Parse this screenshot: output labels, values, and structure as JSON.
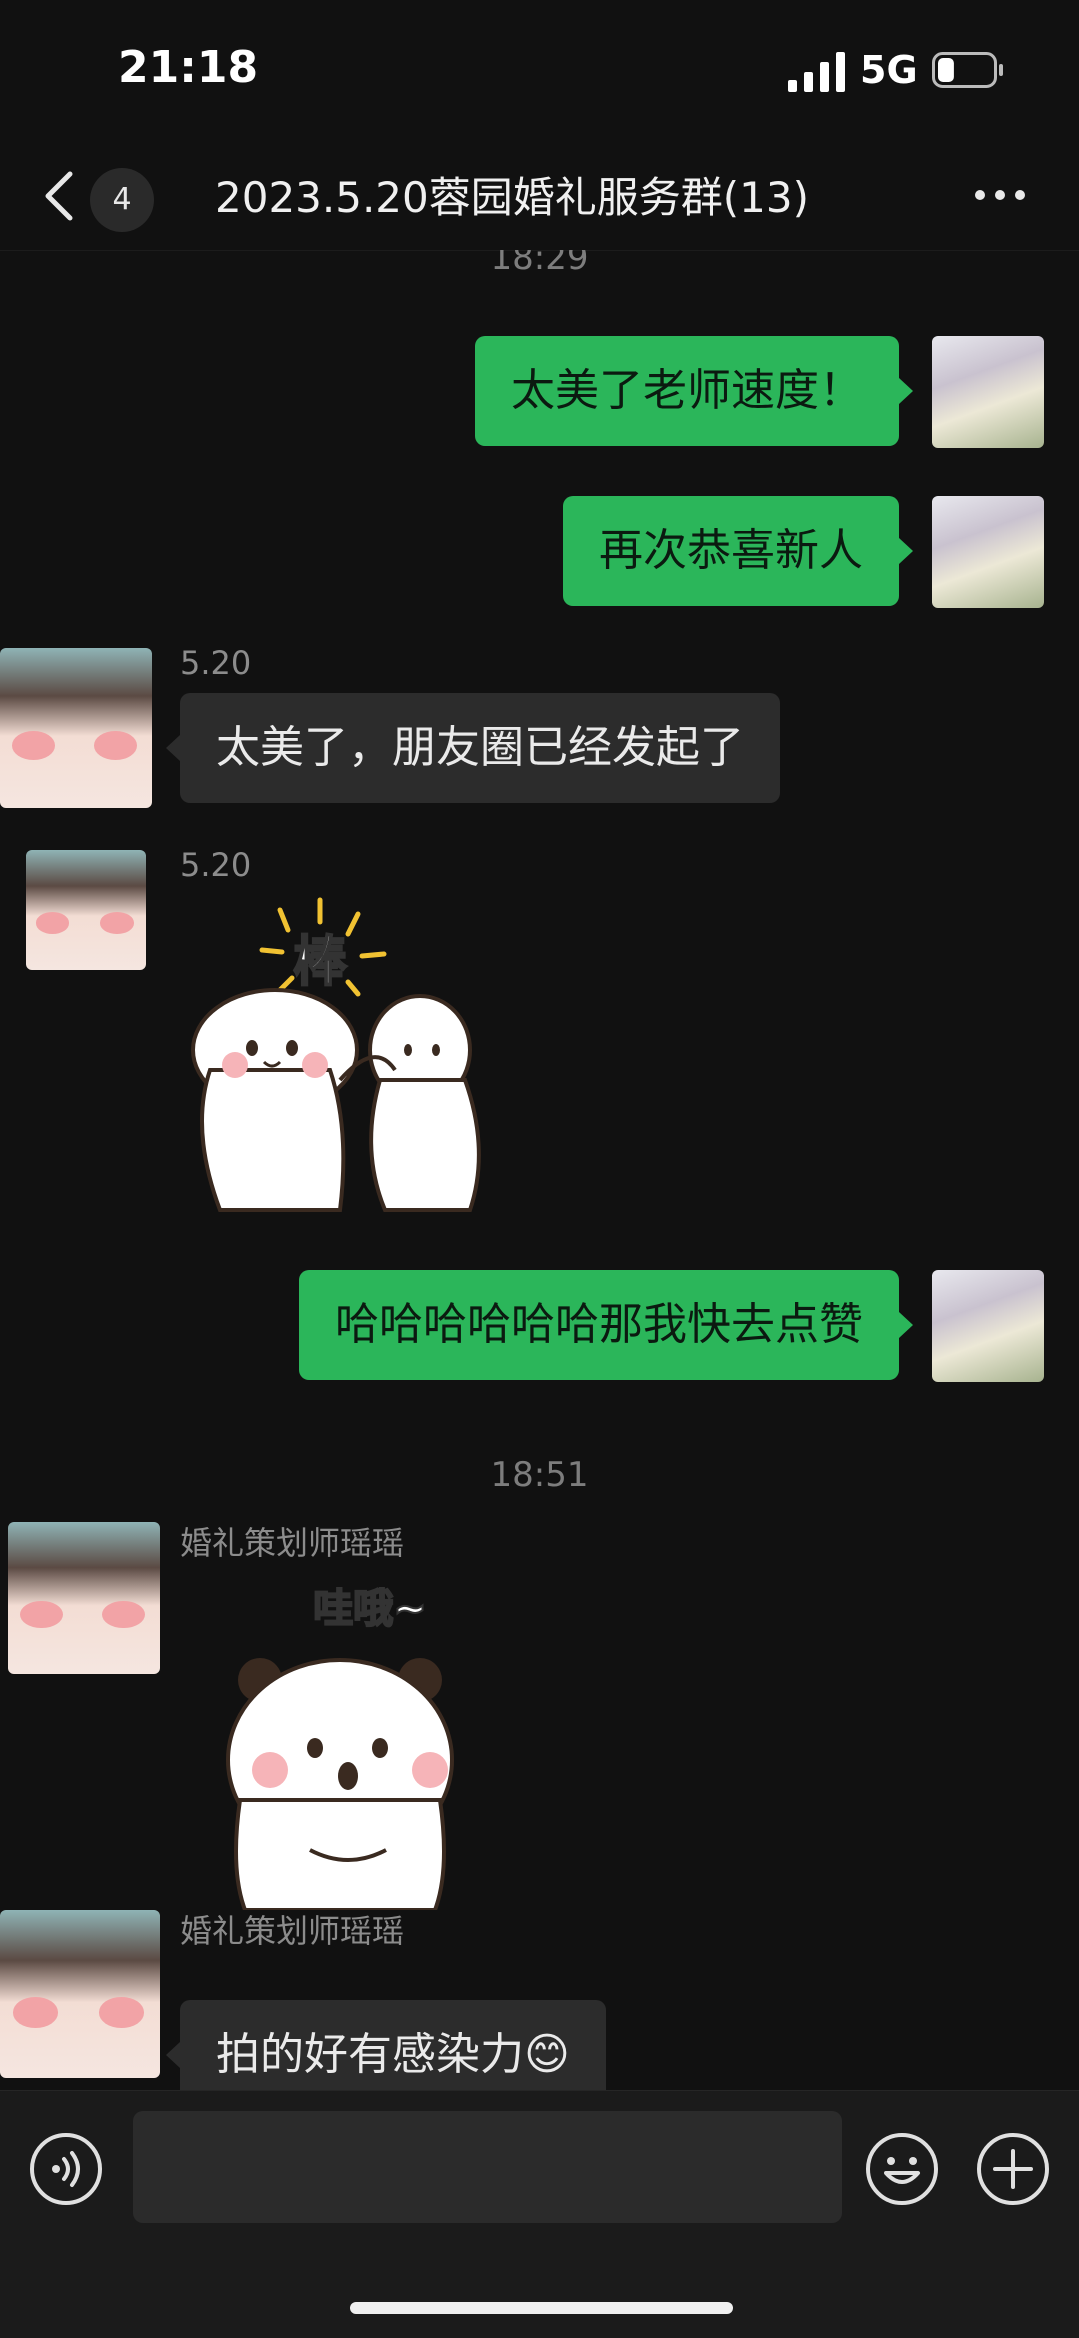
{
  "status_bar": {
    "time": "21:18",
    "network": "5G",
    "battery_level": 0.3
  },
  "header": {
    "unread_count": "4",
    "title": "2023.5.20蓉园婚礼服务群(13)"
  },
  "messages": {
    "ts1": "18:29",
    "m1": "太美了老师速度！",
    "m2": "再次恭喜新人",
    "s3": "5.20",
    "m3": "太美了，朋友圈已经发起了",
    "s4": "5.20",
    "sticker4_text": "棒",
    "m5": "哈哈哈哈哈哈那我快去点赞",
    "ts2": "18:51",
    "s6": "婚礼策划师瑶瑶",
    "sticker6_text": "哇哦~",
    "s7": "婚礼策划师瑶瑶",
    "m7": "拍的好有感染力😊"
  },
  "colors": {
    "my_bubble": "#2bb65a",
    "their_bubble": "#2c2c2c",
    "background": "#111111"
  },
  "icons": [
    "signal-icon",
    "battery-icon",
    "back-arrow-icon",
    "more-icon",
    "voice-icon",
    "emoji-icon",
    "plus-icon"
  ]
}
